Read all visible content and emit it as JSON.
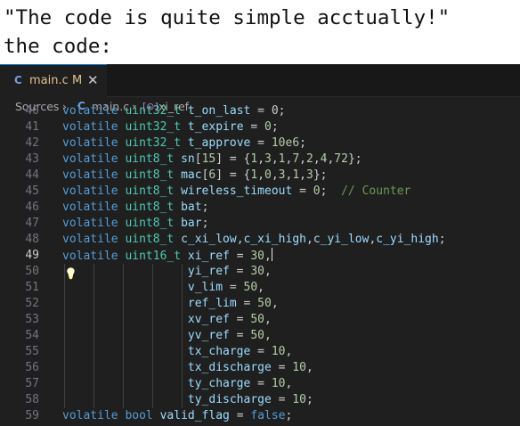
{
  "caption": {
    "line1": "\"The code is quite simple acctually!\"",
    "line2": "the code:"
  },
  "tab": {
    "icon": "C",
    "name": "main.c",
    "status": "M",
    "close": "✕"
  },
  "breadcrumbs": {
    "sources": "Sources",
    "sep1": "›",
    "icon": "C",
    "file": "main.c",
    "sep2": "›",
    "symbol_icon": "[⊙]",
    "symbol": "xi_ref"
  },
  "code_lines": [
    {
      "num": "40",
      "active": false,
      "guides": 0,
      "tokens": [
        [
          "volatile ",
          "k"
        ],
        [
          "uint32_t ",
          "t"
        ],
        [
          "t_on_last",
          "v"
        ],
        [
          " = ",
          ""
        ],
        [
          "0",
          ""
        ],
        [
          ";",
          ""
        ]
      ]
    },
    {
      "num": "41",
      "active": false,
      "guides": 0,
      "tokens": [
        [
          "volatile ",
          "k"
        ],
        [
          "uint32_t ",
          "t"
        ],
        [
          "t_expire",
          "v"
        ],
        [
          " = ",
          ""
        ],
        [
          "0",
          "n"
        ],
        [
          ";",
          ""
        ]
      ]
    },
    {
      "num": "42",
      "active": false,
      "guides": 0,
      "tokens": [
        [
          "volatile ",
          "k"
        ],
        [
          "uint32_t ",
          "t"
        ],
        [
          "t_approve",
          "v"
        ],
        [
          " = ",
          ""
        ],
        [
          "10e6",
          "n"
        ],
        [
          ";",
          ""
        ]
      ]
    },
    {
      "num": "43",
      "active": false,
      "guides": 0,
      "tokens": [
        [
          "volatile ",
          "k"
        ],
        [
          "uint8_t ",
          "t"
        ],
        [
          "sn",
          "v"
        ],
        [
          "[",
          ""
        ],
        [
          "15",
          "n"
        ],
        [
          "] = {",
          ""
        ],
        [
          "1",
          "n"
        ],
        [
          ",",
          ""
        ],
        [
          "3",
          "n"
        ],
        [
          ",",
          ""
        ],
        [
          "1",
          "n"
        ],
        [
          ",",
          ""
        ],
        [
          "7",
          "n"
        ],
        [
          ",",
          ""
        ],
        [
          "2",
          "n"
        ],
        [
          ",",
          ""
        ],
        [
          "4",
          "n"
        ],
        [
          ",",
          ""
        ],
        [
          "72",
          "n"
        ],
        [
          "};",
          ""
        ]
      ]
    },
    {
      "num": "44",
      "active": false,
      "guides": 0,
      "tokens": [
        [
          "volatile ",
          "k"
        ],
        [
          "uint8_t ",
          "t"
        ],
        [
          "mac",
          "v"
        ],
        [
          "[",
          ""
        ],
        [
          "6",
          "n"
        ],
        [
          "] = {",
          ""
        ],
        [
          "1",
          "n"
        ],
        [
          ",",
          ""
        ],
        [
          "0",
          "n"
        ],
        [
          ",",
          ""
        ],
        [
          "3",
          "n"
        ],
        [
          ",",
          ""
        ],
        [
          "1",
          "n"
        ],
        [
          ",",
          ""
        ],
        [
          "3",
          "n"
        ],
        [
          "};",
          ""
        ]
      ]
    },
    {
      "num": "45",
      "active": false,
      "guides": 0,
      "tokens": [
        [
          "volatile ",
          "k"
        ],
        [
          "uint8_t ",
          "t"
        ],
        [
          "wireless_timeout",
          "v"
        ],
        [
          " = ",
          ""
        ],
        [
          "0",
          "n"
        ],
        [
          ";  ",
          ""
        ],
        [
          "// Counter",
          "cm"
        ]
      ]
    },
    {
      "num": "46",
      "active": false,
      "guides": 0,
      "tokens": [
        [
          "volatile ",
          "k"
        ],
        [
          "uint8_t ",
          "t"
        ],
        [
          "bat",
          "v"
        ],
        [
          ";",
          ""
        ]
      ]
    },
    {
      "num": "47",
      "active": false,
      "guides": 0,
      "tokens": [
        [
          "volatile ",
          "k"
        ],
        [
          "uint8_t ",
          "t"
        ],
        [
          "bar",
          "v"
        ],
        [
          ";",
          ""
        ]
      ]
    },
    {
      "num": "48",
      "active": false,
      "guides": 0,
      "tokens": [
        [
          "volatile ",
          "k"
        ],
        [
          "uint8_t ",
          "t"
        ],
        [
          "c_xi_low",
          "v"
        ],
        [
          ",",
          ""
        ],
        [
          "c_xi_high",
          "v"
        ],
        [
          ",",
          ""
        ],
        [
          "c_yi_low",
          "v"
        ],
        [
          ",",
          ""
        ],
        [
          "c_yi_high",
          "v"
        ],
        [
          ";",
          ""
        ]
      ]
    },
    {
      "num": "49",
      "active": true,
      "guides": 0,
      "tokens": [
        [
          "volatile ",
          "k"
        ],
        [
          "uint16_t ",
          "t"
        ],
        [
          "xi_ref",
          "v"
        ],
        [
          " = ",
          ""
        ],
        [
          "30",
          "n"
        ],
        [
          ",",
          ""
        ]
      ],
      "cursor": true
    },
    {
      "num": "50",
      "active": false,
      "guides": 5,
      "bulb": true,
      "tokens": [
        [
          "                  ",
          ""
        ],
        [
          "yi_ref",
          "v"
        ],
        [
          " = ",
          ""
        ],
        [
          "30",
          "n"
        ],
        [
          ",",
          ""
        ]
      ]
    },
    {
      "num": "51",
      "active": false,
      "guides": 5,
      "tokens": [
        [
          "                  ",
          ""
        ],
        [
          "v_lim",
          "v"
        ],
        [
          " = ",
          ""
        ],
        [
          "50",
          "n"
        ],
        [
          ",",
          ""
        ]
      ]
    },
    {
      "num": "52",
      "active": false,
      "guides": 5,
      "tokens": [
        [
          "                  ",
          ""
        ],
        [
          "ref_lim",
          "v"
        ],
        [
          " = ",
          ""
        ],
        [
          "50",
          "n"
        ],
        [
          ",",
          ""
        ]
      ]
    },
    {
      "num": "53",
      "active": false,
      "guides": 5,
      "tokens": [
        [
          "                  ",
          ""
        ],
        [
          "xv_ref",
          "v"
        ],
        [
          " = ",
          ""
        ],
        [
          "50",
          "n"
        ],
        [
          ",",
          ""
        ]
      ]
    },
    {
      "num": "54",
      "active": false,
      "guides": 5,
      "tokens": [
        [
          "                  ",
          ""
        ],
        [
          "yv_ref",
          "v"
        ],
        [
          " = ",
          ""
        ],
        [
          "50",
          "n"
        ],
        [
          ",",
          ""
        ]
      ]
    },
    {
      "num": "55",
      "active": false,
      "guides": 5,
      "tokens": [
        [
          "                  ",
          ""
        ],
        [
          "tx_charge",
          "v"
        ],
        [
          " = ",
          ""
        ],
        [
          "10",
          "n"
        ],
        [
          ",",
          ""
        ]
      ]
    },
    {
      "num": "56",
      "active": false,
      "guides": 5,
      "tokens": [
        [
          "                  ",
          ""
        ],
        [
          "tx_discharge",
          "v"
        ],
        [
          " = ",
          ""
        ],
        [
          "10",
          "n"
        ],
        [
          ",",
          ""
        ]
      ]
    },
    {
      "num": "57",
      "active": false,
      "guides": 5,
      "tokens": [
        [
          "                  ",
          ""
        ],
        [
          "ty_charge",
          "v"
        ],
        [
          " = ",
          ""
        ],
        [
          "10",
          "n"
        ],
        [
          ",",
          ""
        ]
      ]
    },
    {
      "num": "58",
      "active": false,
      "guides": 5,
      "tokens": [
        [
          "                  ",
          ""
        ],
        [
          "ty_discharge",
          "v"
        ],
        [
          " = ",
          ""
        ],
        [
          "10",
          "n"
        ],
        [
          ";",
          ""
        ]
      ]
    },
    {
      "num": "59",
      "active": false,
      "guides": 0,
      "tokens": [
        [
          "volatile ",
          "k"
        ],
        [
          "bool ",
          "k"
        ],
        [
          "valid_flag",
          "v"
        ],
        [
          " = ",
          ""
        ],
        [
          "false",
          "k"
        ],
        [
          ";",
          ""
        ]
      ]
    }
  ],
  "colors": {
    "editor_bg": "#1f1f1f",
    "keyword": "#569cd6",
    "type": "#4ec9b0",
    "variable": "#9cdcfe",
    "number": "#b5cea8",
    "comment": "#6a9955"
  }
}
